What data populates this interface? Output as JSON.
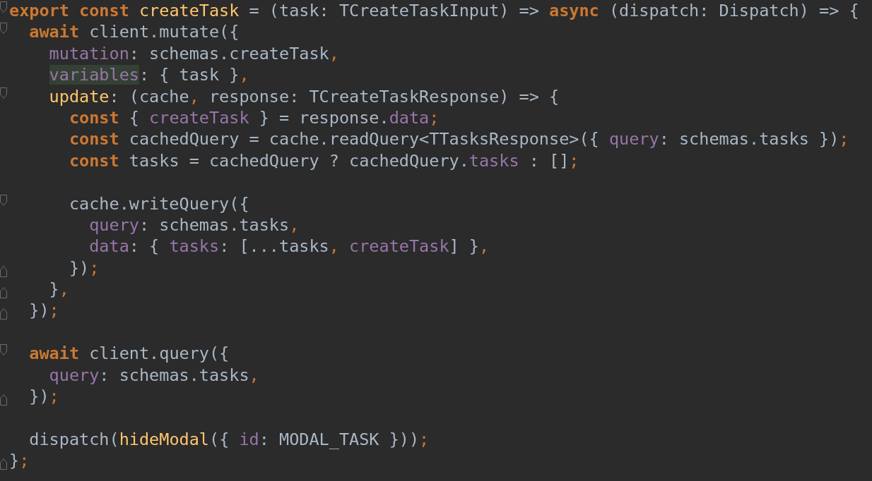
{
  "editor": {
    "lines": [
      {
        "fold_start": true,
        "tokens": [
          {
            "kind": "keyword",
            "text": "export const "
          },
          {
            "kind": "function",
            "text": "createTask"
          },
          {
            "kind": "plain",
            "text": " = (task: TCreateTaskInput) => "
          },
          {
            "kind": "keyword",
            "text": "async"
          },
          {
            "kind": "plain",
            "text": " (dispatch: Dispatch) => {"
          }
        ]
      },
      {
        "fold_start": true,
        "tokens": [
          {
            "kind": "keyword",
            "text": "  await"
          },
          {
            "kind": "plain",
            "text": " client.mutate({"
          }
        ]
      },
      {
        "tokens": [
          {
            "kind": "property",
            "text": "    mutation"
          },
          {
            "kind": "plain",
            "text": ": schemas.createTask"
          },
          {
            "kind": "punct",
            "text": ","
          }
        ]
      },
      {
        "tokens": [
          {
            "kind": "property",
            "text": "    variables",
            "highlighted": true
          },
          {
            "kind": "plain",
            "text": ": { task }"
          },
          {
            "kind": "punct",
            "text": ","
          }
        ]
      },
      {
        "fold_start": true,
        "tokens": [
          {
            "kind": "function",
            "text": "    update"
          },
          {
            "kind": "plain",
            "text": ": (cache"
          },
          {
            "kind": "punct",
            "text": ","
          },
          {
            "kind": "plain",
            "text": " response: TCreateTaskResponse) => {"
          }
        ]
      },
      {
        "tokens": [
          {
            "kind": "keyword",
            "text": "      const"
          },
          {
            "kind": "plain",
            "text": " { "
          },
          {
            "kind": "property",
            "text": "createTask"
          },
          {
            "kind": "plain",
            "text": " } = response."
          },
          {
            "kind": "property",
            "text": "data"
          },
          {
            "kind": "punct",
            "text": ";"
          }
        ]
      },
      {
        "tokens": [
          {
            "kind": "keyword",
            "text": "      const"
          },
          {
            "kind": "plain",
            "text": " cachedQuery = cache.readQuery<TTasksResponse>({ "
          },
          {
            "kind": "property",
            "text": "query"
          },
          {
            "kind": "plain",
            "text": ": schemas.tasks })"
          },
          {
            "kind": "punct",
            "text": ";"
          }
        ]
      },
      {
        "tokens": [
          {
            "kind": "keyword",
            "text": "      const"
          },
          {
            "kind": "plain",
            "text": " tasks = cachedQuery ? cachedQuery."
          },
          {
            "kind": "property",
            "text": "tasks"
          },
          {
            "kind": "plain",
            "text": " : []"
          },
          {
            "kind": "punct",
            "text": ";"
          }
        ]
      },
      {
        "blank": true
      },
      {
        "fold_start": true,
        "tokens": [
          {
            "kind": "plain",
            "text": "      cache.writeQuery({"
          }
        ]
      },
      {
        "tokens": [
          {
            "kind": "property",
            "text": "        query"
          },
          {
            "kind": "plain",
            "text": ": schemas.tasks"
          },
          {
            "kind": "punct",
            "text": ","
          }
        ]
      },
      {
        "tokens": [
          {
            "kind": "property",
            "text": "        data"
          },
          {
            "kind": "plain",
            "text": ": { "
          },
          {
            "kind": "property",
            "text": "tasks"
          },
          {
            "kind": "plain",
            "text": ": [...tasks"
          },
          {
            "kind": "punct",
            "text": ", "
          },
          {
            "kind": "property",
            "text": "createTask"
          },
          {
            "kind": "plain",
            "text": "] }"
          },
          {
            "kind": "punct",
            "text": ","
          }
        ]
      },
      {
        "fold_end": true,
        "tokens": [
          {
            "kind": "plain",
            "text": "      })"
          },
          {
            "kind": "punct",
            "text": ";"
          }
        ]
      },
      {
        "fold_end": true,
        "tokens": [
          {
            "kind": "plain",
            "text": "    }"
          },
          {
            "kind": "punct",
            "text": ","
          }
        ]
      },
      {
        "fold_end": true,
        "tokens": [
          {
            "kind": "plain",
            "text": "  })"
          },
          {
            "kind": "punct",
            "text": ";"
          }
        ]
      },
      {
        "blank": true
      },
      {
        "fold_start": true,
        "tokens": [
          {
            "kind": "keyword",
            "text": "  await"
          },
          {
            "kind": "plain",
            "text": " client.query({"
          }
        ]
      },
      {
        "tokens": [
          {
            "kind": "property",
            "text": "    query"
          },
          {
            "kind": "plain",
            "text": ": schemas.tasks"
          },
          {
            "kind": "punct",
            "text": ","
          }
        ]
      },
      {
        "fold_end": true,
        "tokens": [
          {
            "kind": "plain",
            "text": "  })"
          },
          {
            "kind": "punct",
            "text": ";"
          }
        ]
      },
      {
        "blank": true
      },
      {
        "tokens": [
          {
            "kind": "plain",
            "text": "  dispatch("
          },
          {
            "kind": "function",
            "text": "hideModal"
          },
          {
            "kind": "plain",
            "text": "({ "
          },
          {
            "kind": "property",
            "text": "id"
          },
          {
            "kind": "plain",
            "text": ": MODAL_TASK }))"
          },
          {
            "kind": "punct",
            "text": ";"
          }
        ]
      },
      {
        "fold_end": true,
        "tokens": [
          {
            "kind": "plain",
            "text": "}"
          },
          {
            "kind": "punct",
            "text": ";"
          }
        ]
      }
    ]
  }
}
